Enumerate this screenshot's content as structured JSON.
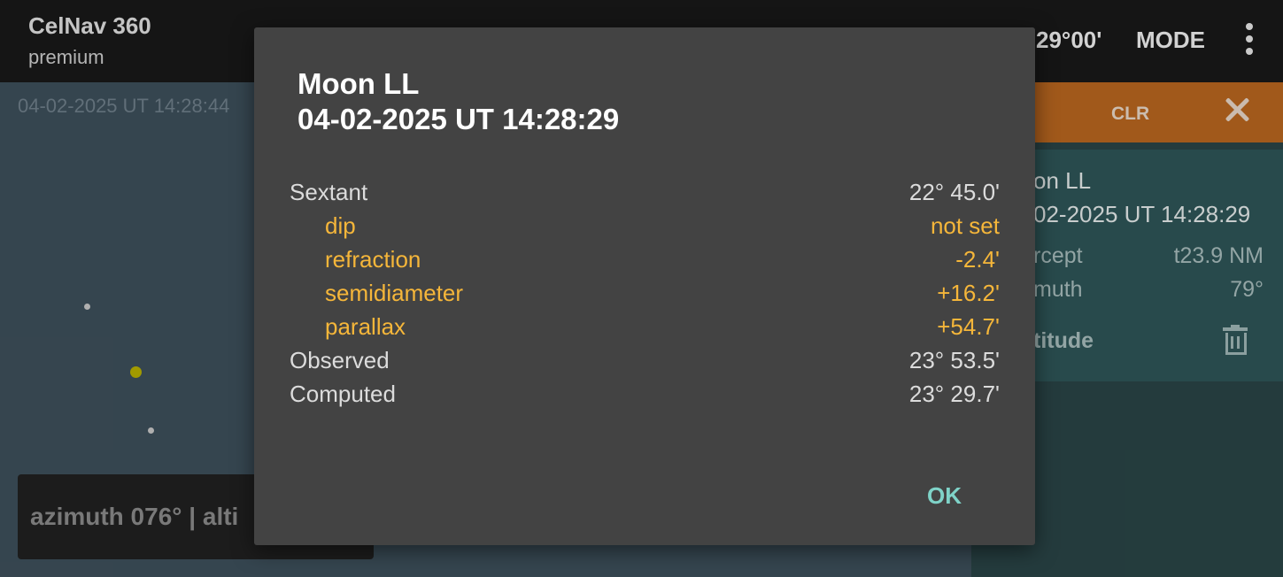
{
  "appbar": {
    "title": "CelNav 360",
    "subtitle": "premium",
    "coordinate_fragment": "29°00'",
    "mode_label": "MODE",
    "menu_icon": "overflow-menu-icon"
  },
  "sky": {
    "timestamp": "04-02-2025 UT 14:28:44",
    "azimuth_text": "azimuth 076°  |  alti"
  },
  "right_panel": {
    "clr_label": "CLR",
    "close_icon": "close-icon",
    "card": {
      "title": "on LL",
      "time": "02-2025 UT 14:28:29",
      "rows": [
        {
          "label": "rcept",
          "value": "t23.9 NM"
        },
        {
          "label": "muth",
          "value": "79°"
        }
      ],
      "altitude_label": "titude",
      "delete_icon": "trash-icon"
    }
  },
  "dialog": {
    "title_line1": "Moon LL",
    "title_line2": "04-02-2025 UT 14:28:29",
    "rows": [
      {
        "label": "Sextant",
        "value": "22° 45.0'",
        "kind": "main"
      },
      {
        "label": "dip",
        "value": "not set",
        "kind": "sub"
      },
      {
        "label": "refraction",
        "value": "-2.4'",
        "kind": "sub"
      },
      {
        "label": "semidiameter",
        "value": "+16.2'",
        "kind": "sub"
      },
      {
        "label": "parallax",
        "value": "+54.7'",
        "kind": "sub"
      },
      {
        "label": "Observed",
        "value": "23° 53.5'",
        "kind": "main"
      },
      {
        "label": "Computed",
        "value": "23° 29.7'",
        "kind": "main"
      }
    ],
    "ok_label": "OK"
  },
  "colors": {
    "accent_orange": "#b8661f",
    "correction_text": "#f5b63a",
    "ok_button": "#7fd3c8"
  }
}
